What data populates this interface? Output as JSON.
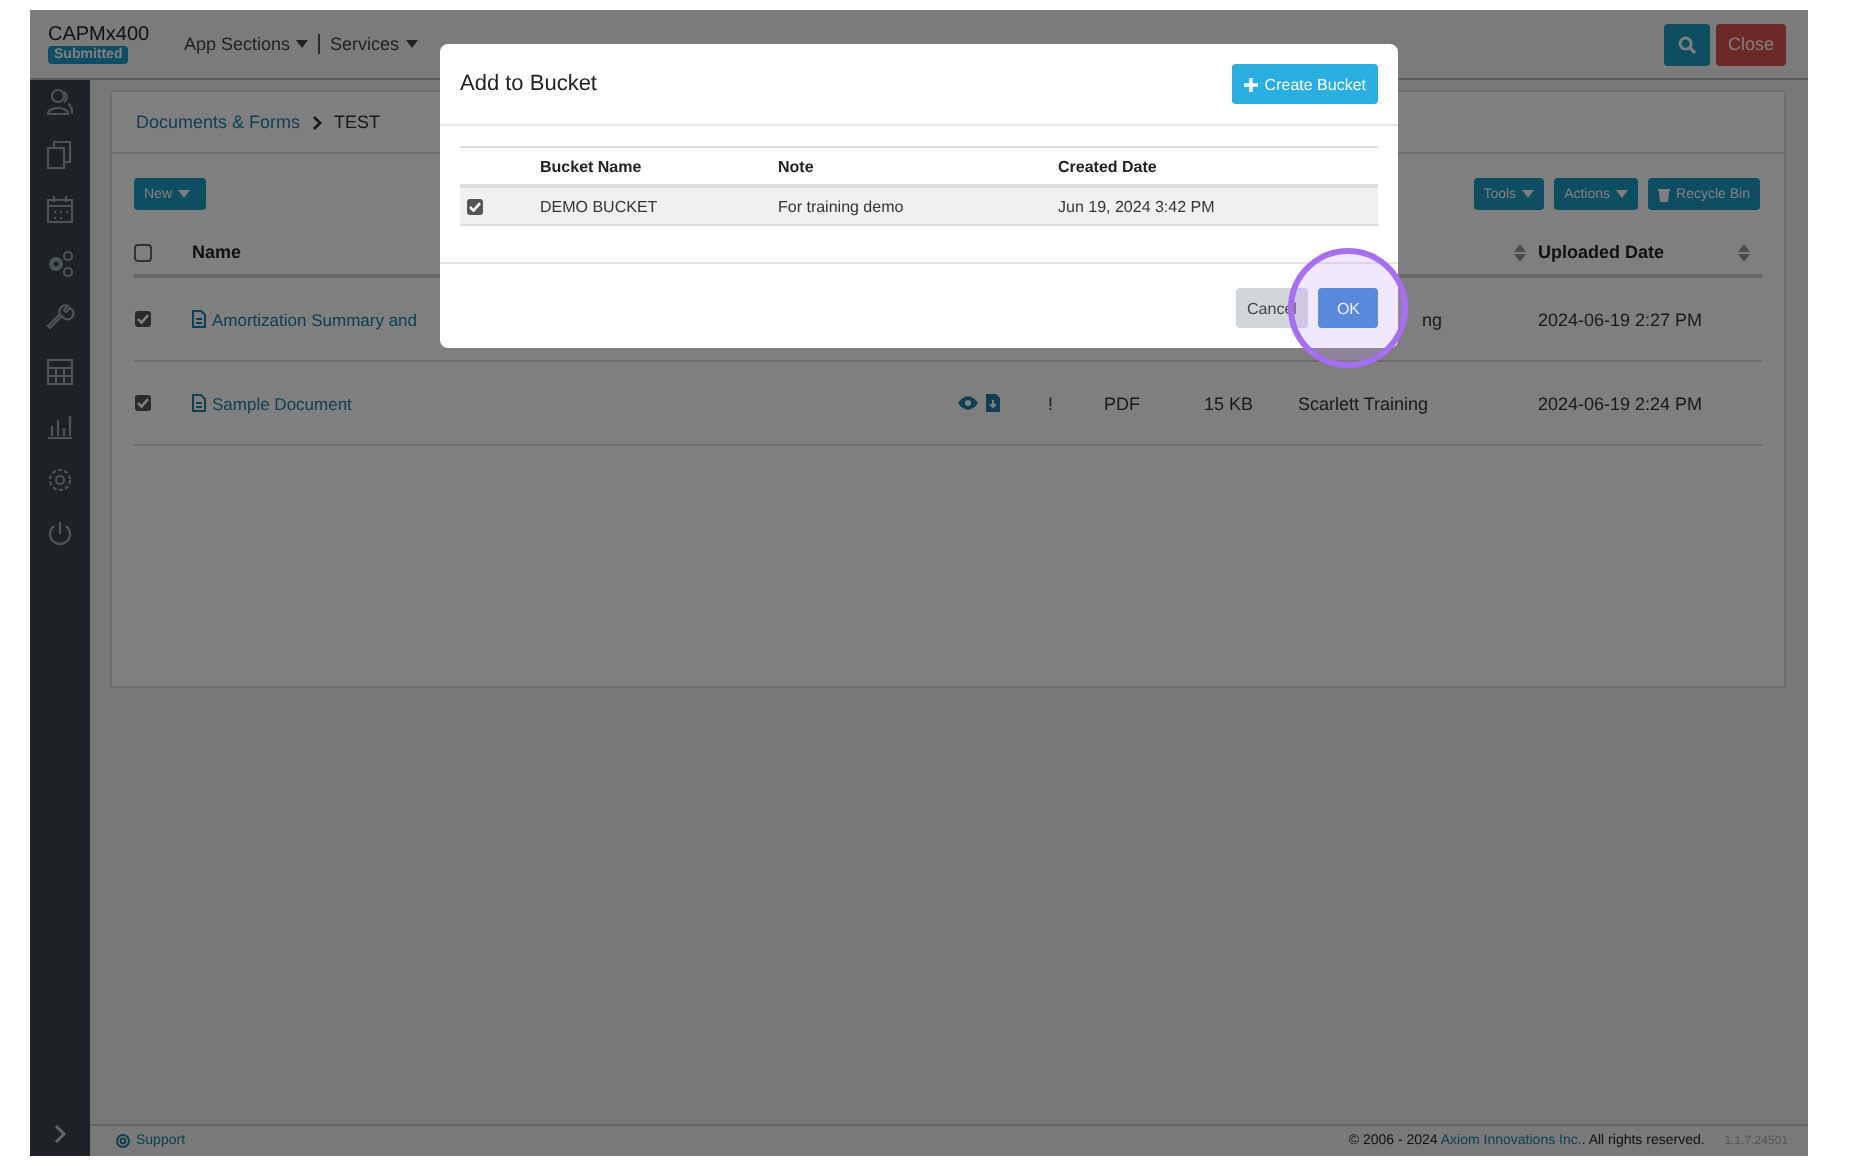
{
  "app": {
    "name": "CAPMx400",
    "status_badge": "Submitted",
    "nav": [
      {
        "label": "App Sections",
        "dropdown": true
      },
      {
        "label": "Services",
        "dropdown": true
      }
    ],
    "buttons": [
      {
        "kind": "search"
      },
      {
        "kind": "danger",
        "label": "Close"
      }
    ]
  },
  "breadcrumb": [
    "Documents & Forms",
    "TEST"
  ],
  "toolbar": {
    "new_button": "New",
    "right_buttons": [
      {
        "label": "Tools",
        "kind": "dropdown"
      },
      {
        "label": "Actions",
        "kind": "dropdown"
      },
      {
        "label": "Recycle Bin",
        "kind": "trash"
      }
    ]
  },
  "documents": {
    "select_all_checked": false,
    "columns": [
      {
        "label": "Name",
        "sortable": false
      },
      {
        "sortable": true
      },
      {
        "label": "Uploaded Date",
        "sortable": true
      }
    ],
    "rows": [
      {
        "checked": true,
        "name": "Amortization Summary and",
        "uploaded_by": "ng",
        "uploaded_date": "2024-06-19 2:27 PM"
      },
      {
        "checked": true,
        "name": "Sample Document",
        "flag": "!",
        "type": "PDF",
        "size": "15 KB",
        "uploaded_by": "Scarlett Training",
        "uploaded_date": "2024-06-19 2:24 PM"
      }
    ]
  },
  "footer": {
    "support": "Support",
    "copyright": "© 2006 - 2024",
    "company": "Axiom Innovations Inc.",
    "rights": ". All rights reserved.",
    "version": "1.1.7.24501"
  },
  "dialog": {
    "title": "Add to Bucket",
    "create_button": "Create Bucket",
    "columns": [
      "Bucket Name",
      "Note",
      "Created Date"
    ],
    "rows": [
      {
        "checked": true,
        "name": "DEMO BUCKET",
        "note": "For training demo",
        "created": "Jun 19, 2024 3:42 PM"
      }
    ],
    "buttons": [
      {
        "label": "Cancel",
        "kind": "secondary",
        "highlighted": false
      },
      {
        "label": "OK",
        "kind": "primary",
        "highlighted": true
      }
    ]
  }
}
